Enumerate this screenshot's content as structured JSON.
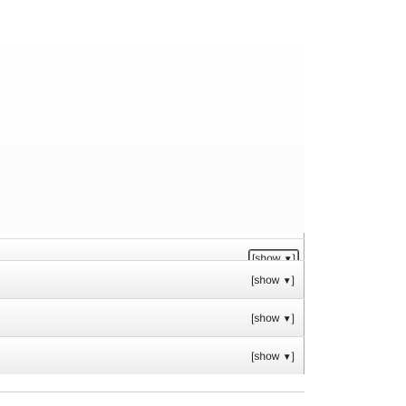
{
  "toggles": {
    "items": [
      {
        "label": "[show ",
        "arrow": "▼",
        "close": "]"
      },
      {
        "label": "[show ",
        "arrow": "▼",
        "close": "]"
      },
      {
        "label": "[show ",
        "arrow": "▼",
        "close": "]"
      },
      {
        "label": "[show ",
        "arrow": "▼",
        "close": "]"
      }
    ]
  }
}
